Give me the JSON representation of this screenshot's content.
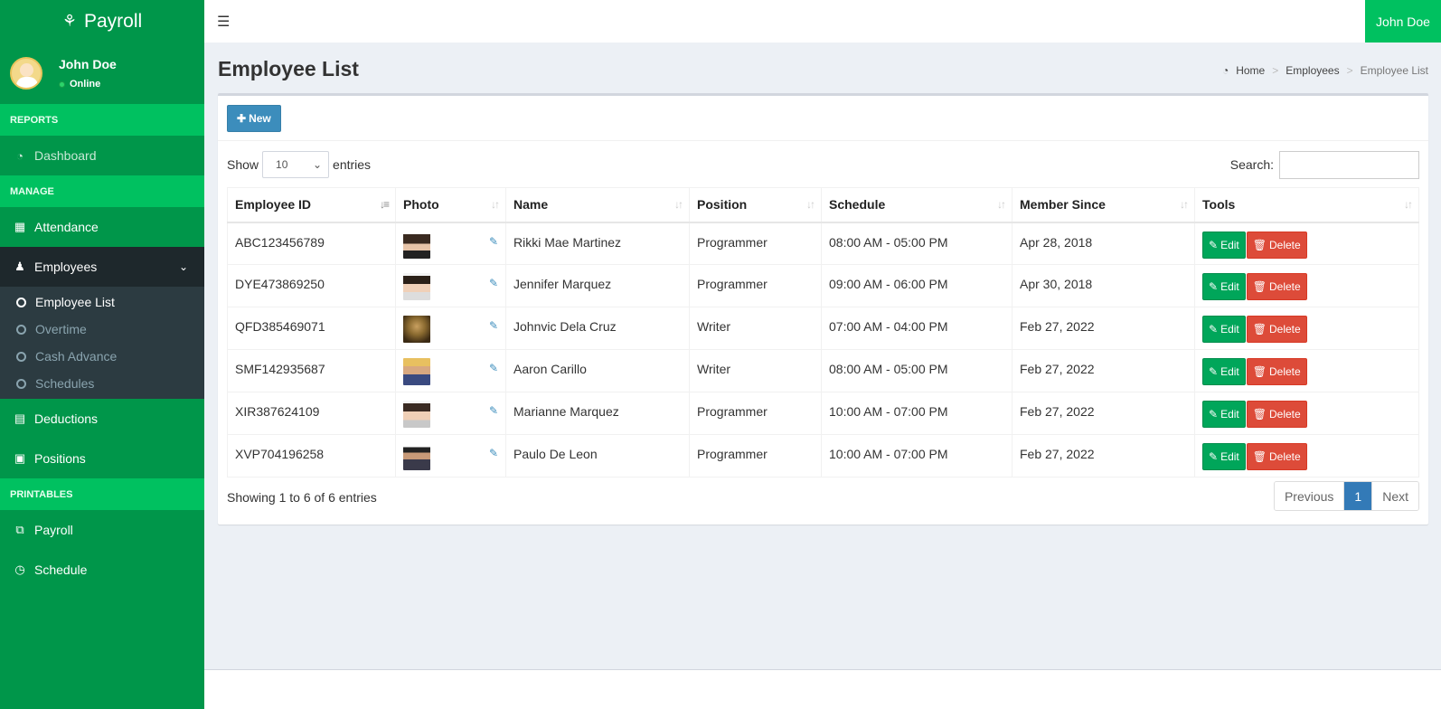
{
  "app": {
    "brand": "Payroll"
  },
  "user": {
    "name": "John Doe",
    "status": "Online"
  },
  "sidebar": {
    "headers": [
      "REPORTS",
      "MANAGE",
      "PRINTABLES"
    ],
    "dashboard": "Dashboard",
    "attendance": "Attendance",
    "employees": "Employees",
    "submenu": [
      "Employee List",
      "Overtime",
      "Cash Advance",
      "Schedules"
    ],
    "deductions": "Deductions",
    "positions": "Positions",
    "payroll": "Payroll",
    "schedule": "Schedule"
  },
  "topbar": {
    "user": "John Doe"
  },
  "page": {
    "title": "Employee List",
    "breadcrumb": [
      "Home",
      "Employees",
      "Employee List"
    ]
  },
  "toolbar": {
    "new_label": "New"
  },
  "table_controls": {
    "show_label": "Show",
    "entries_value": "10",
    "entries_label": "entries",
    "search_label": "Search:"
  },
  "table": {
    "columns": [
      "Employee ID",
      "Photo",
      "Name",
      "Position",
      "Schedule",
      "Member Since",
      "Tools"
    ],
    "rows": [
      {
        "id": "ABC123456789",
        "name": "Rikki Mae Martinez",
        "position": "Programmer",
        "schedule": "08:00 AM - 05:00 PM",
        "since": "Apr 28, 2018"
      },
      {
        "id": "DYE473869250",
        "name": "Jennifer Marquez",
        "position": "Programmer",
        "schedule": "09:00 AM - 06:00 PM",
        "since": "Apr 30, 2018"
      },
      {
        "id": "QFD385469071",
        "name": "Johnvic Dela Cruz",
        "position": "Writer",
        "schedule": "07:00 AM - 04:00 PM",
        "since": "Feb 27, 2022"
      },
      {
        "id": "SMF142935687",
        "name": "Aaron Carillo",
        "position": "Writer",
        "schedule": "08:00 AM - 05:00 PM",
        "since": "Feb 27, 2022"
      },
      {
        "id": "XIR387624109",
        "name": "Marianne Marquez",
        "position": "Programmer",
        "schedule": "10:00 AM - 07:00 PM",
        "since": "Feb 27, 2022"
      },
      {
        "id": "XVP704196258",
        "name": "Paulo De Leon",
        "position": "Programmer",
        "schedule": "10:00 AM - 07:00 PM",
        "since": "Feb 27, 2022"
      }
    ],
    "edit_label": "Edit",
    "delete_label": "Delete"
  },
  "pagination": {
    "info": "Showing 1 to 6 of 6 entries",
    "previous": "Previous",
    "current": "1",
    "next": "Next"
  },
  "colors": {
    "sidebar": "#00964a",
    "accent": "#00c160",
    "primary": "#3c8dbc",
    "success": "#00a65a",
    "danger": "#dd4b39"
  }
}
